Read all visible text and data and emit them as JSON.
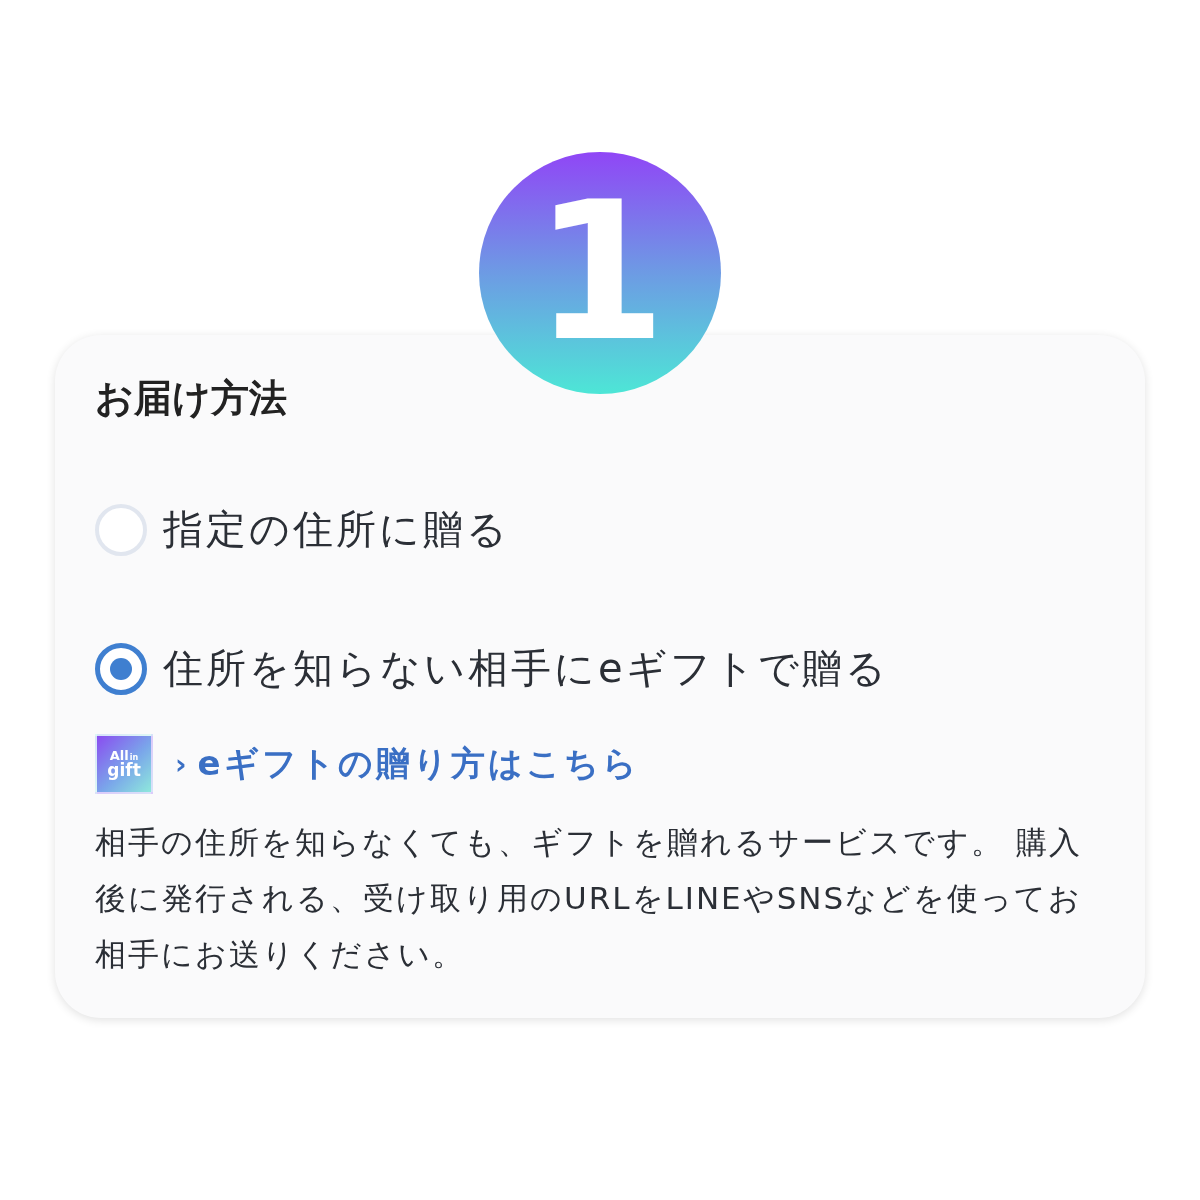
{
  "step_badge": {
    "number": "1"
  },
  "section": {
    "title": "お届け方法",
    "options": [
      {
        "label": "指定の住所に贈る",
        "selected": false
      },
      {
        "label": "住所を知らない相手にeギフトで贈る",
        "selected": true
      }
    ],
    "gift_logo": {
      "line_1": "All",
      "line_1_small": "in",
      "line_2": "gift"
    },
    "link": {
      "chevron": "›",
      "text": "eギフトの贈り方はこちら"
    },
    "description": "相手の住所を知らなくても、ギフトを贈れるサービスです。 購入後に発行される、受け取り用のURLをLINEやSNSなどを使ってお相手にお送りください。"
  }
}
